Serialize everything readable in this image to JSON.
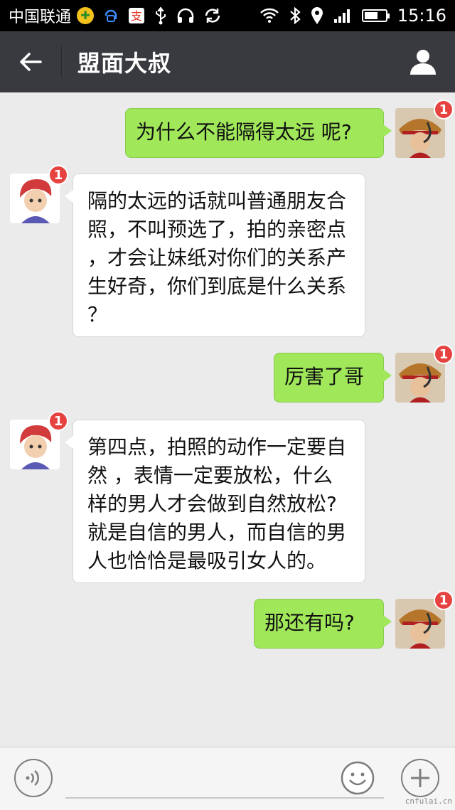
{
  "status_bar": {
    "carrier": "中国联通",
    "time": "15:16",
    "icons": [
      "cross-plus-icon",
      "headset-bot-icon",
      "alipay-icon",
      "usb-icon",
      "headphones-icon",
      "sync-icon",
      "wifi-icon",
      "bluetooth-icon",
      "location-icon",
      "signal-icon",
      "battery-icon"
    ]
  },
  "header": {
    "title": "盟面大叔",
    "back_icon": "arrow-left-icon",
    "profile_icon": "person-icon"
  },
  "messages": [
    {
      "direction": "out",
      "text": "为什么不能隔得太远 呢?",
      "badge": "1"
    },
    {
      "direction": "in",
      "lines": [
        "隔的太远的话就叫普通朋友合",
        "照，不叫预选了，拍的亲密点",
        "，才会让妹纸对你们的关系产",
        "生好奇，你们到底是什么关系",
        "？"
      ],
      "badge": "1"
    },
    {
      "direction": "out",
      "text": "厉害了哥",
      "badge": "1"
    },
    {
      "direction": "in",
      "lines": [
        "第四点，拍照的动作一定要自",
        "然 ，表情一定要放松，什么",
        "样的男人才会做到自然放松?",
        "就是自信的男人，而自信的男",
        "人也恰恰是最吸引女人的。"
      ],
      "badge": "1"
    },
    {
      "direction": "out",
      "text": "那还有吗?",
      "badge": "1"
    }
  ],
  "input_bar": {
    "voice_icon": "voice-icon",
    "emoji_icon": "smiley-icon",
    "plus_icon": "plus-icon"
  },
  "watermark": "cnfulai.cn",
  "colors": {
    "outgoing_bubble": "#a0e75a",
    "incoming_bubble": "#ffffff",
    "header": "#393a3f",
    "badge": "#e64340"
  }
}
